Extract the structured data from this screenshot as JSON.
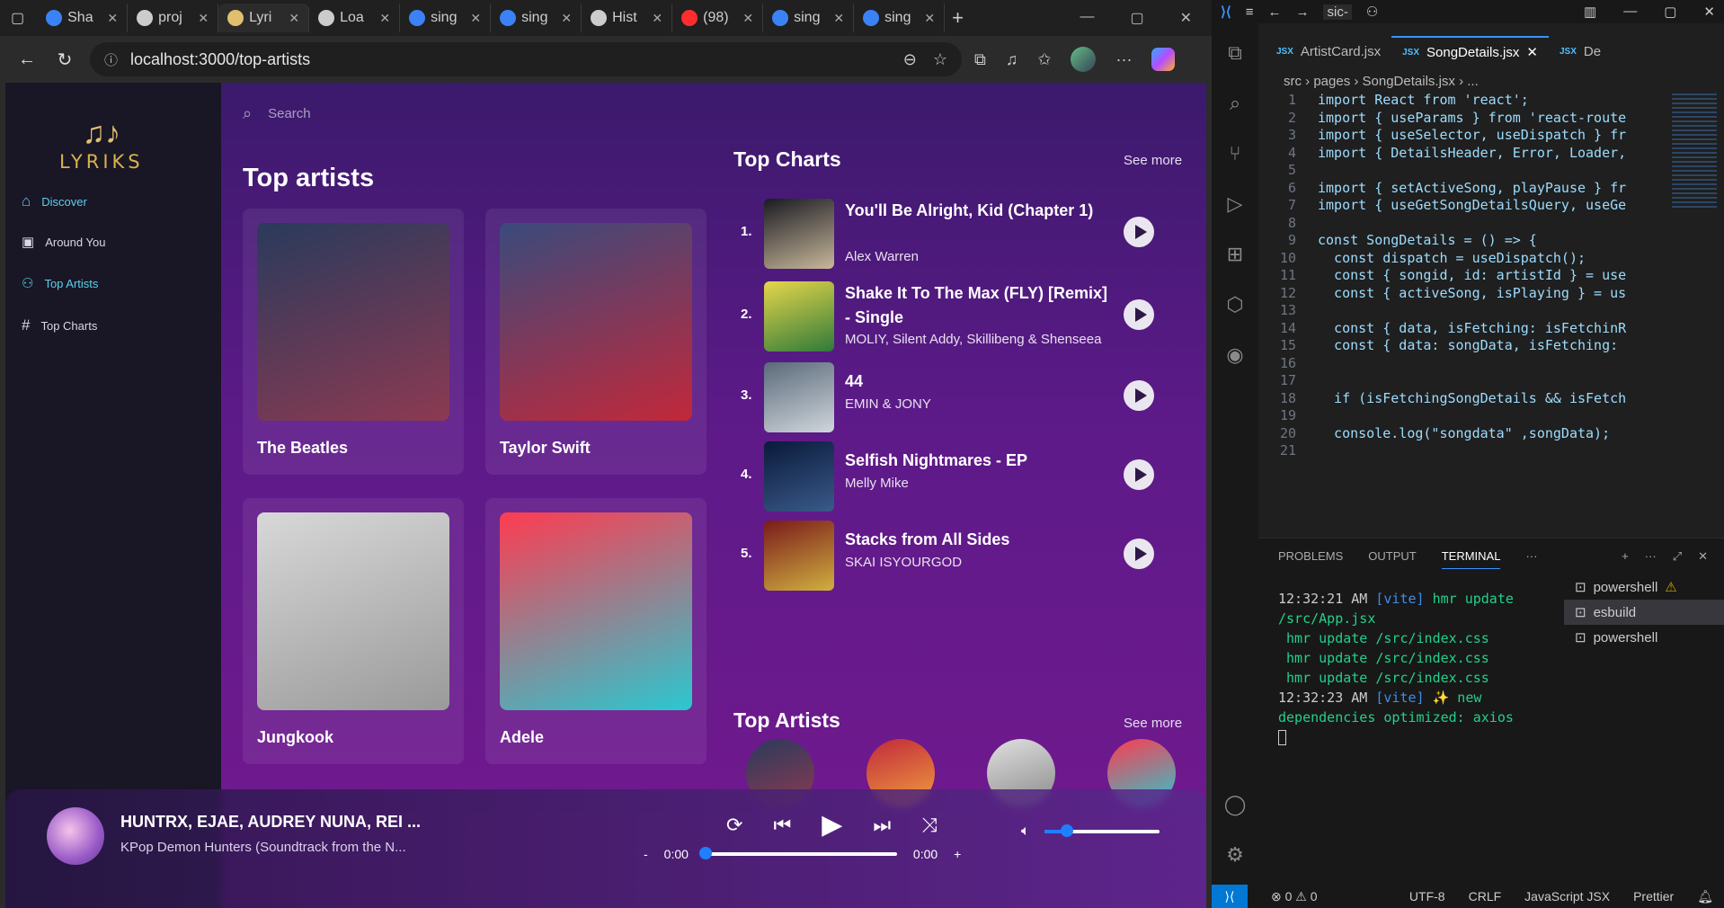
{
  "browser": {
    "tabs": [
      {
        "label": "Sha",
        "color": "#3b82f6"
      },
      {
        "label": "proj",
        "color": "#cccccc"
      },
      {
        "label": "Lyri",
        "color": "#e0c070"
      },
      {
        "label": "Loa",
        "color": "#cccccc"
      },
      {
        "label": "sing",
        "color": "#3b82f6"
      },
      {
        "label": "sing",
        "color": "#3b82f6"
      },
      {
        "label": "Hist",
        "color": "#cccccc"
      },
      {
        "label": "(98)",
        "color": "#ff2d2d"
      },
      {
        "label": "sing",
        "color": "#3b82f6"
      },
      {
        "label": "sing",
        "color": "#3b82f6"
      }
    ],
    "url": "localhost:3000/top-artists"
  },
  "app": {
    "logo_notes": "♫♪",
    "logo_word": "LYRIKS",
    "nav": [
      {
        "label": "Discover",
        "icon": "home-icon",
        "active": true
      },
      {
        "label": "Around You",
        "icon": "image-icon",
        "active": false
      },
      {
        "label": "Top Artists",
        "icon": "users-icon",
        "active": true
      },
      {
        "label": "Top Charts",
        "icon": "hash-icon",
        "active": false
      }
    ],
    "search_placeholder": "Search",
    "page_title": "Top artists",
    "artists": [
      {
        "name": "The Beatles",
        "gradient": [
          "#2a3a5c",
          "#8c3a52"
        ]
      },
      {
        "name": "Taylor Swift",
        "gradient": [
          "#3a4a7c",
          "#c2283a"
        ]
      },
      {
        "name": "Jungkook",
        "gradient": [
          "#d8d8d8",
          "#9a9a9a"
        ]
      },
      {
        "name": "Adele",
        "gradient": [
          "#ff3b50",
          "#2ac8d0"
        ]
      }
    ],
    "top_charts_heading": "Top Charts",
    "see_more": "See more",
    "charts": [
      {
        "rank": "1.",
        "title": "You'll Be Alright, Kid (Chapter 1)",
        "artist": "Alex Warren",
        "thumb": [
          "#1a1a22",
          "#c8b89a"
        ]
      },
      {
        "rank": "2.",
        "title": "Shake It To The Max (FLY) [Remix] - Single",
        "artist": "MOLIY, Silent Addy, Skillibeng & Shenseea",
        "thumb": [
          "#e6d64a",
          "#2f7a3a"
        ]
      },
      {
        "rank": "3.",
        "title": "44",
        "artist": "EMIN & JONY",
        "thumb": [
          "#5a6a7a",
          "#d0d6dc"
        ]
      },
      {
        "rank": "4.",
        "title": "Selfish Nightmares - EP",
        "artist": "Melly Mike",
        "thumb": [
          "#0a1a3a",
          "#3a5a8a"
        ]
      },
      {
        "rank": "5.",
        "title": "Stacks from All Sides",
        "artist": "SKAI ISYOURGOD",
        "thumb": [
          "#7a1a1a",
          "#d0b040"
        ]
      }
    ],
    "top_artists_heading": "Top Artists",
    "top_artist_avatars": [
      {
        "gradient": [
          "#2a3a5c",
          "#8c3a52"
        ]
      },
      {
        "gradient": [
          "#c2283a",
          "#f0a040"
        ]
      },
      {
        "gradient": [
          "#e0e0e0",
          "#8a8a8a"
        ]
      },
      {
        "gradient": [
          "#ff3b50",
          "#2ac8d0"
        ]
      }
    ],
    "player": {
      "title": "HUNTRX, EJAE, AUDREY NUNA, REI ...",
      "subtitle": "KPop Demon Hunters (Soundtrack from the N...",
      "time_minus": "-",
      "time_current": "0:00",
      "time_total": "0:00",
      "time_plus": "+",
      "progress": 0,
      "volume": 0.2
    }
  },
  "vscode": {
    "title_text": "sic-",
    "tabs": [
      "ArtistCard.jsx",
      "SongDetails.jsx",
      "De"
    ],
    "jsx_badge": "JSX",
    "breadcrumb": "src › pages › SongDetails.jsx › ...",
    "code": [
      {
        "n": "1",
        "text": "import React from 'react';"
      },
      {
        "n": "2",
        "text": "import { useParams } from 'react-route"
      },
      {
        "n": "3",
        "text": "import { useSelector, useDispatch } fr"
      },
      {
        "n": "4",
        "text": "import { DetailsHeader, Error, Loader,"
      },
      {
        "n": "5",
        "text": ""
      },
      {
        "n": "6",
        "text": "import { setActiveSong, playPause } fr"
      },
      {
        "n": "7",
        "text": "import { useGetSongDetailsQuery, useGe"
      },
      {
        "n": "8",
        "text": ""
      },
      {
        "n": "9",
        "text": "const SongDetails = () => {"
      },
      {
        "n": "10",
        "text": "  const dispatch = useDispatch();"
      },
      {
        "n": "11",
        "text": "  const { songid, id: artistId } = use"
      },
      {
        "n": "12",
        "text": "  const { activeSong, isPlaying } = us"
      },
      {
        "n": "13",
        "text": ""
      },
      {
        "n": "14",
        "text": "  const { data, isFetching: isFetchinR"
      },
      {
        "n": "15",
        "text": "  const { data: songData, isFetching:"
      },
      {
        "n": "16",
        "text": ""
      },
      {
        "n": "17",
        "text": ""
      },
      {
        "n": "18",
        "text": "  if (isFetchingSongDetails && isFetch"
      },
      {
        "n": "19",
        "text": ""
      },
      {
        "n": "20",
        "text": "  console.log(\"songdata\" ,songData);"
      },
      {
        "n": "21",
        "text": ""
      }
    ],
    "panel_tabs": [
      "PROBLEMS",
      "OUTPUT",
      "TERMINAL",
      "···"
    ],
    "terminal": [
      {
        "time": "12:32:21 AM",
        "tag": "[vite]",
        "msg": " hmr update /src/App.jsx"
      },
      {
        "time": "",
        "tag": "",
        "msg": "hmr update /src/index.css"
      },
      {
        "time": "",
        "tag": "",
        "msg": "hmr update /src/index.css"
      },
      {
        "time": "",
        "tag": "",
        "msg": "hmr update /src/index.css"
      },
      {
        "time": "12:32:23 AM",
        "tag": "[vite]",
        "msg": " ✨ new dependencies optimized: axios"
      }
    ],
    "terminals": [
      "powershell",
      "esbuild",
      "powershell"
    ],
    "status": {
      "errors": "⊗ 0",
      "warnings": "⚠ 0",
      "encoding": "UTF-8",
      "eol": "CRLF",
      "language": "JavaScript JSX",
      "formatter": "Prettier"
    }
  }
}
